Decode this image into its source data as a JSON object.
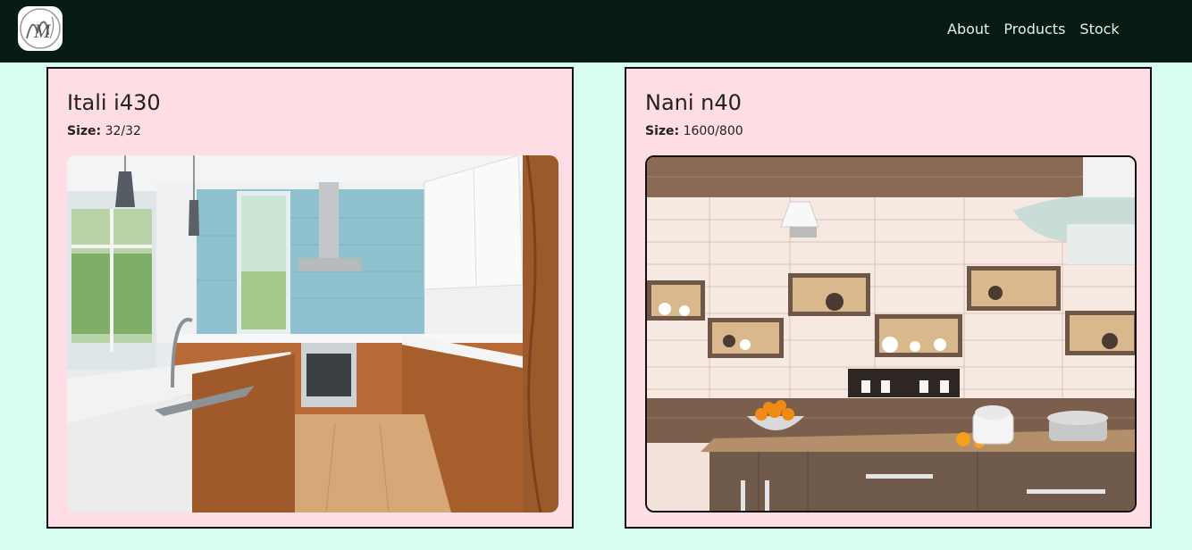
{
  "navbar": {
    "logo_letter": "M",
    "links": [
      "About",
      "Products",
      "Stock"
    ]
  },
  "products": [
    {
      "name": "Itali i430",
      "size_label": "Size:",
      "size_value": "32/32",
      "image": "modern kitchen with blue tile backsplash and wooden cabinets"
    },
    {
      "name": "Nani n40",
      "size_label": "Size:",
      "size_value": "1600/800",
      "image": "kitchen wall tiles with niche shelves, teapots and cups"
    }
  ]
}
